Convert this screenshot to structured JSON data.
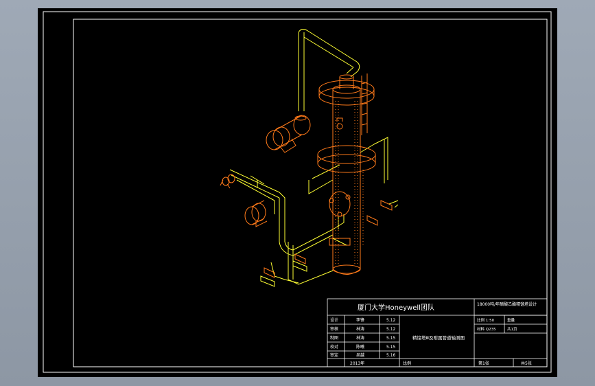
{
  "colors": {
    "background": "#000000",
    "frame": "#ffffff",
    "pipe_lines": "#ffff33",
    "equipment": "#ff7a1a"
  },
  "title_block": {
    "team_name": "厦门大学Honeywell团队",
    "project_title": "18000吨/年醋酸乙酯精馏塔设计",
    "drawing_name": "精馏塔Ⅲ及附属管道轴测图",
    "drawing_code": "",
    "sheet_label": "第1张",
    "total_label": "共5张",
    "year": "2013年",
    "rows": [
      {
        "role": "设计",
        "name": "李锋",
        "date": "5.12"
      },
      {
        "role": "审核",
        "name": "林涛",
        "date": "5.12"
      },
      {
        "role": "制图",
        "name": "林涛",
        "date": "5.15"
      },
      {
        "role": "校对",
        "name": "陈曦",
        "date": "5.15"
      },
      {
        "role": "审定",
        "name": "吴越",
        "date": "5.16"
      }
    ],
    "right_rows": [
      "比例 1:50",
      "重量",
      "材料 Q235",
      "共1页"
    ],
    "scale_label": "比例"
  }
}
